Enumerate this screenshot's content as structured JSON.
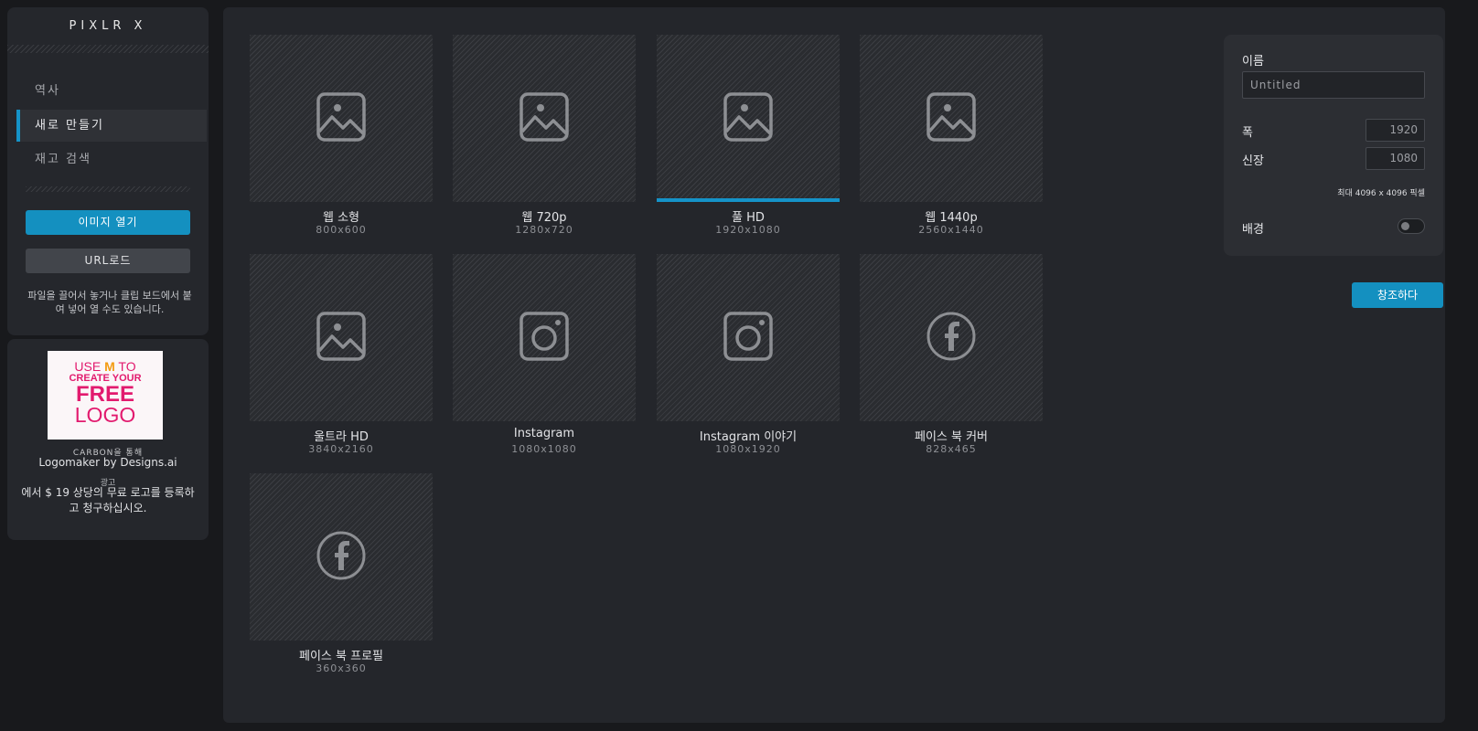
{
  "app": {
    "logo": "PIXLR X"
  },
  "sidebar": {
    "nav": [
      {
        "label": "역사",
        "active": false
      },
      {
        "label": "새로 만들기",
        "active": true
      },
      {
        "label": "재고 검색",
        "active": false
      }
    ],
    "open_image_label": "이미지 열기",
    "url_load_label": "URL로드",
    "drag_hint": "파일을 끌어서 놓거나 클립 보드에서 붙여 넣어 열 수도 있습니다."
  },
  "ad": {
    "image_text": [
      "USE",
      "TO",
      "CREATE YOUR",
      "FREE",
      "LOGO"
    ],
    "via": "CARBON을 통해",
    "title": "Logomaker by Designs.ai",
    "label": "광고",
    "description": "에서 $ 19 상당의 무료 로고를 등록하고 청구하십시오."
  },
  "templates": [
    {
      "name": "웹 소형",
      "size": "800x600",
      "icon": "image-icon",
      "selected": false
    },
    {
      "name": "웹 720p",
      "size": "1280x720",
      "icon": "image-icon",
      "selected": false
    },
    {
      "name": "풀 HD",
      "size": "1920x1080",
      "icon": "image-icon",
      "selected": true
    },
    {
      "name": "웹 1440p",
      "size": "2560x1440",
      "icon": "image-icon",
      "selected": false
    },
    {
      "name": "울트라 HD",
      "size": "3840x2160",
      "icon": "image-icon",
      "selected": false
    },
    {
      "name": "Instagram",
      "size": "1080x1080",
      "icon": "instagram-icon",
      "selected": false
    },
    {
      "name": "Instagram 이야기",
      "size": "1080x1920",
      "icon": "instagram-icon",
      "selected": false
    },
    {
      "name": "페이스 북 커버",
      "size": "828x465",
      "icon": "facebook-icon",
      "selected": false
    },
    {
      "name": "페이스 북 프로필",
      "size": "360x360",
      "icon": "facebook-icon",
      "selected": false
    }
  ],
  "settings": {
    "name_label": "이름",
    "name_value": "Untitled",
    "width_label": "폭",
    "width_value": "1920",
    "height_label": "신장",
    "height_value": "1080",
    "max_note": "최대 4096 x 4096 픽셀",
    "background_label": "배경",
    "background_on": false,
    "create_label": "창조하다"
  },
  "colors": {
    "accent": "#1490c0",
    "panel": "#25272c",
    "background": "#18191c"
  }
}
